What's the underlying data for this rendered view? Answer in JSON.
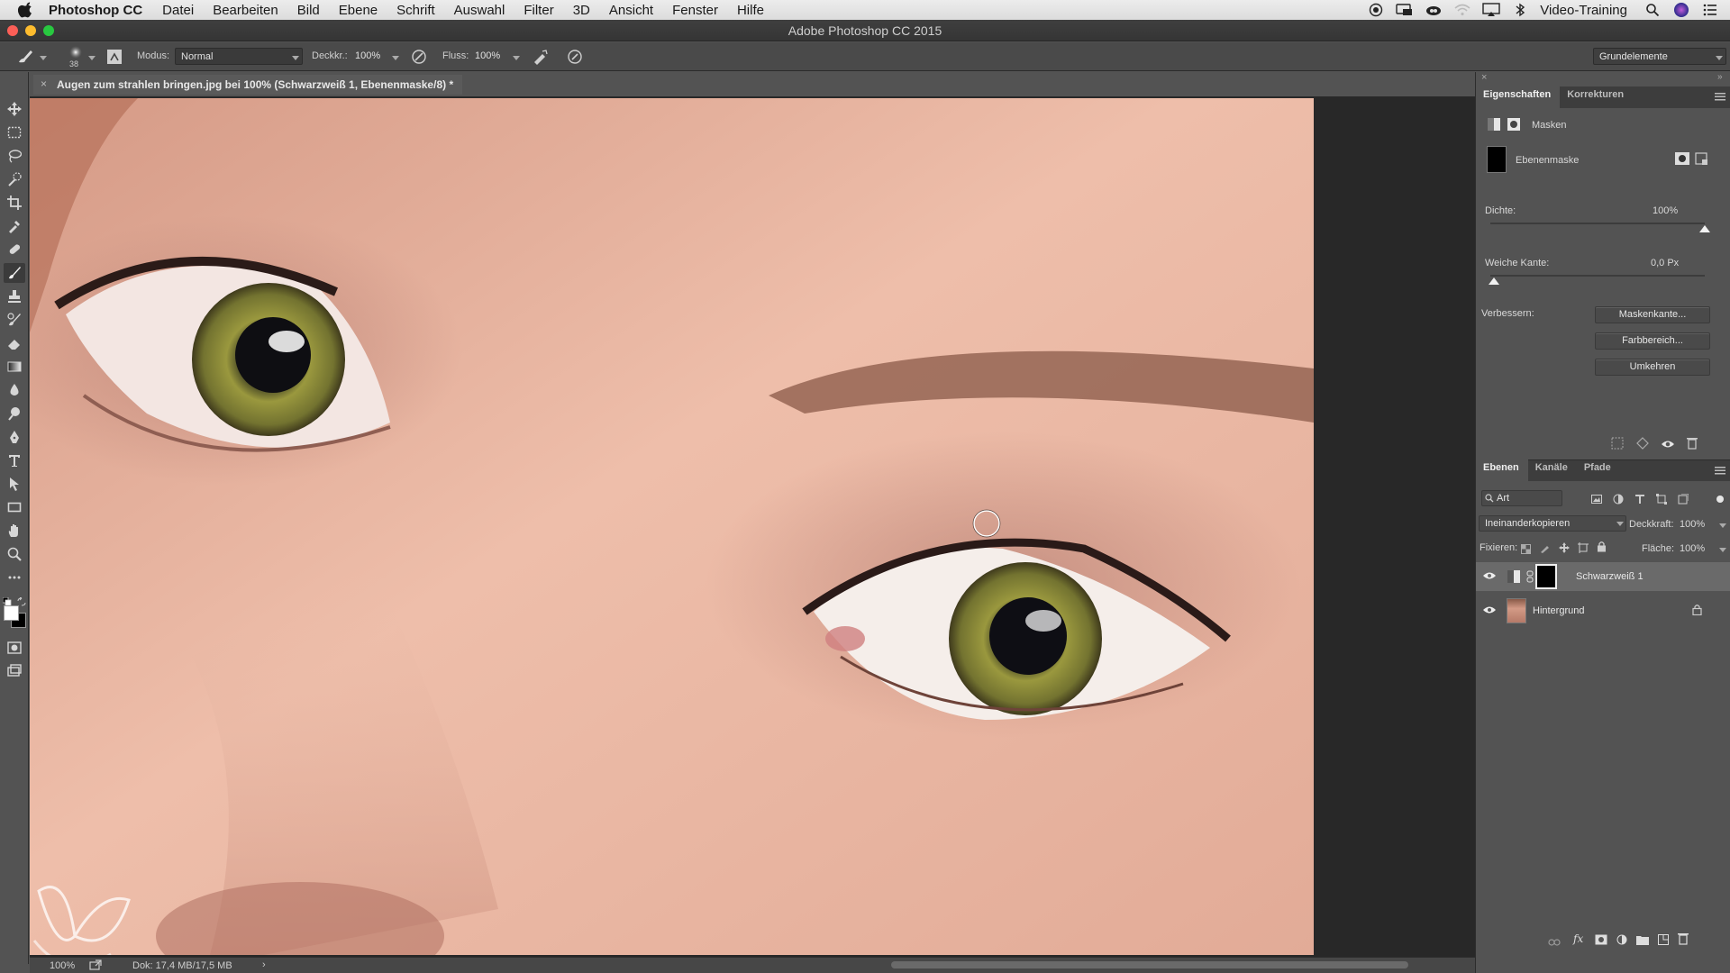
{
  "menubar": {
    "app_name": "Photoshop CC",
    "menus": [
      "Datei",
      "Bearbeiten",
      "Bild",
      "Ebene",
      "Schrift",
      "Auswahl",
      "Filter",
      "3D",
      "Ansicht",
      "Fenster",
      "Hilfe"
    ],
    "user": "Video-Training"
  },
  "window": {
    "title": "Adobe Photoshop CC 2015"
  },
  "options": {
    "brush_size": "38",
    "mode_label": "Modus:",
    "mode_value": "Normal",
    "opacity_label": "Deckkr.:",
    "opacity_value": "100%",
    "flow_label": "Fluss:",
    "flow_value": "100%",
    "workspace": "Grundelemente"
  },
  "document": {
    "tab_title": "Augen zum strahlen bringen.jpg bei 100% (Schwarzweiß 1, Ebenenmaske/8) *",
    "zoom": "100%",
    "doc_size": "Dok: 17,4 MB/17,5 MB"
  },
  "properties": {
    "tabs": [
      "Eigenschaften",
      "Korrekturen"
    ],
    "section": "Masken",
    "mask_label": "Ebenenmaske",
    "density_label": "Dichte:",
    "density_value": "100%",
    "density": 1.0,
    "feather_label": "Weiche Kante:",
    "feather_value": "0,0 Px",
    "feather": 0.0,
    "refine_label": "Verbessern:",
    "buttons": [
      "Maskenkante...",
      "Farbbereich...",
      "Umkehren"
    ]
  },
  "layers": {
    "tabs": [
      "Ebenen",
      "Kanäle",
      "Pfade"
    ],
    "filter_kind": "Art",
    "blend_mode": "Ineinanderkopieren",
    "opacity_label": "Deckkraft:",
    "opacity_value": "100%",
    "lock_label": "Fixieren:",
    "fill_label": "Fläche:",
    "fill_value": "100%",
    "items": [
      {
        "name": "Schwarzweiß 1",
        "selected": true
      },
      {
        "name": "Hintergrund",
        "selected": false
      }
    ]
  },
  "colors": {
    "accent_close": "#fc5f57",
    "accent_min": "#fdbc2e",
    "accent_max": "#28c840",
    "iris": "#8a8a3a",
    "skin": "#e5b8a3"
  }
}
